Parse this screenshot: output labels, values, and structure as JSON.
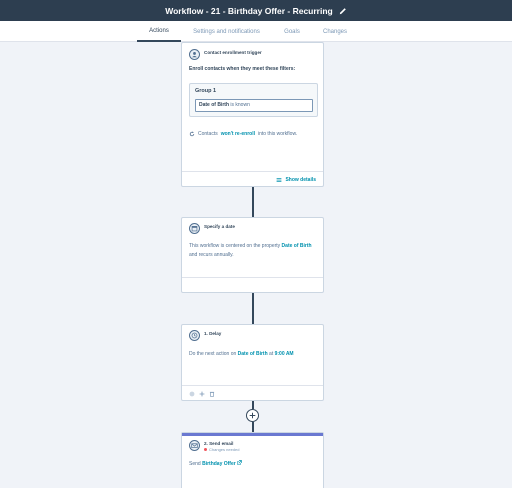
{
  "header": {
    "title": "Workflow - 21 - Birthday Offer - Recurring",
    "edit_icon": "pencil-icon"
  },
  "tabs": [
    {
      "label": "Actions",
      "active": true
    },
    {
      "label": "Settings and notifications",
      "active": false
    },
    {
      "label": "Goals",
      "active": false
    },
    {
      "label": "Changes",
      "active": false
    }
  ],
  "trigger_card": {
    "title": "Contact enrollment trigger",
    "heading": "Enroll contacts when they meet these filters:",
    "group_label": "Group 1",
    "filter_property": "Date of Birth",
    "filter_condition": "is known",
    "reenroll_prefix": "Contacts",
    "reenroll_emphasis": "won't re-enroll",
    "reenroll_suffix": "into this workflow.",
    "show_details_label": "Show details",
    "icon": "enrollment-trigger-icon"
  },
  "date_card": {
    "title": "Specify a date",
    "text_before": "This workflow is centered on the property",
    "property": "Date of Birth",
    "text_after": "and recurs annually.",
    "icon": "calendar-icon"
  },
  "delay_card": {
    "title": "1. Delay",
    "text_before": "Do the next action on",
    "property": "Date of Birth",
    "text_mid": "at",
    "time": "9:00 AM",
    "icon": "clock-icon"
  },
  "email_card": {
    "title": "2. Send email",
    "status": "Changes needed",
    "text_before": "Send",
    "email_name": "Birthday Offer",
    "icon": "email-icon",
    "accent": "#6a78d1"
  },
  "colors": {
    "topbar": "#2d3e50",
    "background": "#f0f3f8",
    "link": "#0091ae",
    "connector": "#33475b"
  }
}
